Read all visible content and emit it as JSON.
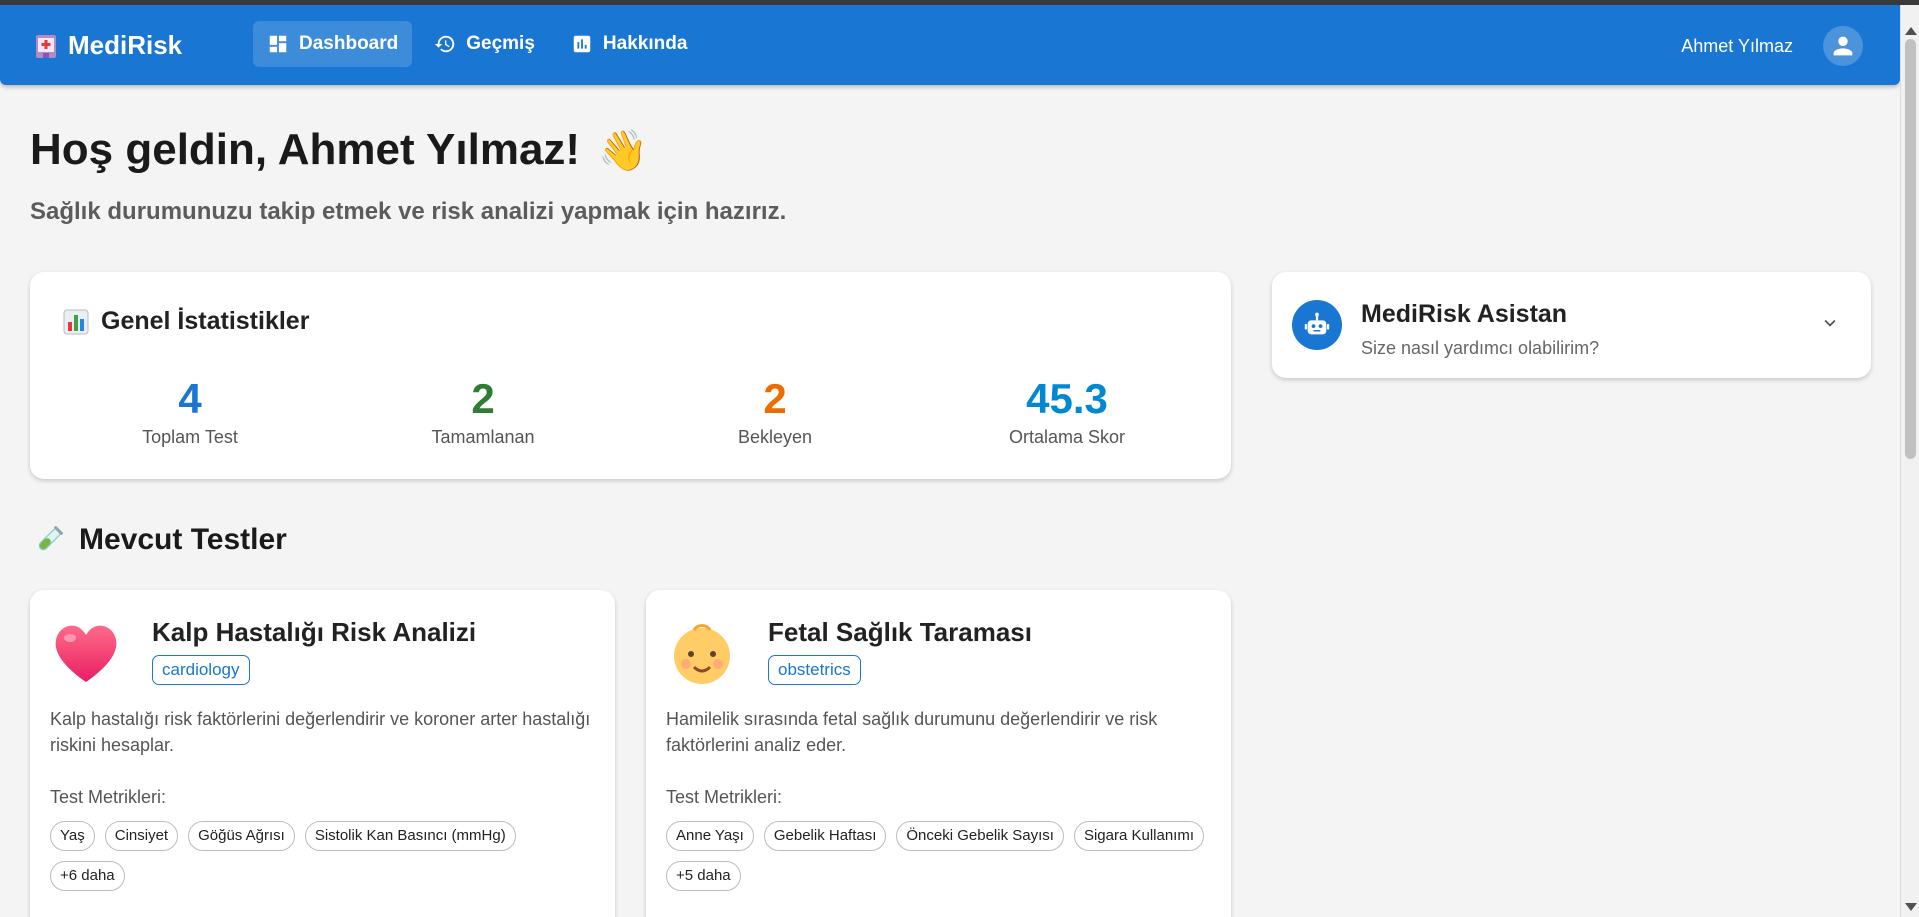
{
  "app": {
    "name": "MediRisk",
    "nav": [
      {
        "label": "Dashboard",
        "icon": "dashboard-icon",
        "active": true
      },
      {
        "label": "Geçmiş",
        "icon": "history-icon",
        "active": false
      },
      {
        "label": "Hakkında",
        "icon": "bar-chart-icon",
        "active": false
      }
    ],
    "user_name": "Ahmet Yılmaz"
  },
  "greeting": {
    "title": "Hoş geldin, Ahmet Yılmaz!",
    "emoji": "👋",
    "subtitle": "Sağlık durumunuzu takip etmek ve risk analizi yapmak için hazırız."
  },
  "stats": {
    "title": "Genel İstatistikler",
    "icon": "bar-chart-emoji",
    "items": [
      {
        "value": "4",
        "label": "Toplam Test",
        "color": "#1976d2"
      },
      {
        "value": "2",
        "label": "Tamamlanan",
        "color": "#2e7d32"
      },
      {
        "value": "2",
        "label": "Bekleyen",
        "color": "#ed6c02"
      },
      {
        "value": "45.3",
        "label": "Ortalama Skor",
        "color": "#0288d1"
      }
    ]
  },
  "assistant": {
    "title": "MediRisk Asistan",
    "subtitle": "Size nasıl yardımcı olabilirim?"
  },
  "tests": {
    "section_title": "Mevcut Testler",
    "metrics_label": "Test Metrikleri:",
    "items": [
      {
        "icon": "heart-emoji",
        "title": "Kalp Hastalığı Risk Analizi",
        "tag": "cardiology",
        "description": "Kalp hastalığı risk faktörlerini değerlendirir ve koroner arter hastalığı riskini hesaplar.",
        "metrics": [
          "Yaş",
          "Cinsiyet",
          "Göğüs Ağrısı",
          "Sistolik Kan Basıncı (mmHg)",
          "+6 daha"
        ]
      },
      {
        "icon": "baby-emoji",
        "title": "Fetal Sağlık Taraması",
        "tag": "obstetrics",
        "description": "Hamilelik sırasında fetal sağlık durumunu değerlendirir ve risk faktörlerini analiz eder.",
        "metrics": [
          "Anne Yaşı",
          "Gebelik Haftası",
          "Önceki Gebelik Sayısı",
          "Sigara Kullanımı",
          "+5 daha"
        ]
      }
    ]
  },
  "colors": {
    "primary": "#1976d2",
    "background": "#f4f4f4"
  }
}
